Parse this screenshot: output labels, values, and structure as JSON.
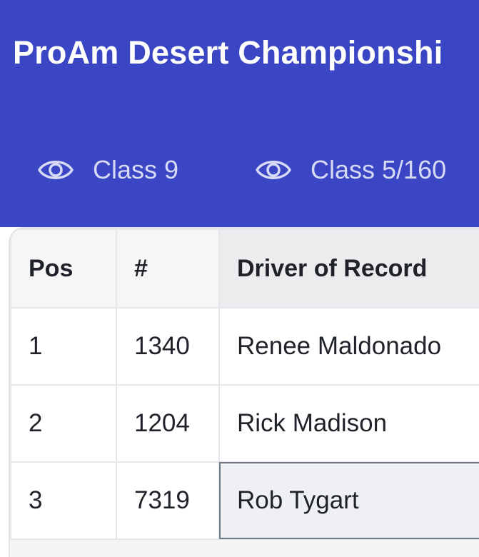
{
  "header": {
    "title": "ProAm Desert Championshi",
    "tabs": [
      {
        "label": "Class 9",
        "icon": "eye-icon"
      },
      {
        "label": "Class 5/160",
        "icon": "eye-icon"
      }
    ],
    "background_color": "#3a46c4"
  },
  "table": {
    "columns": [
      "Pos",
      "#",
      "Driver of Record"
    ],
    "rows": [
      {
        "pos": "1",
        "number": "1340",
        "driver": "Renee Maldonado"
      },
      {
        "pos": "2",
        "number": "1204",
        "driver": "Rick Madison"
      },
      {
        "pos": "3",
        "number": "7319",
        "driver": "Rob Tygart"
      }
    ],
    "selected_row": 3
  }
}
